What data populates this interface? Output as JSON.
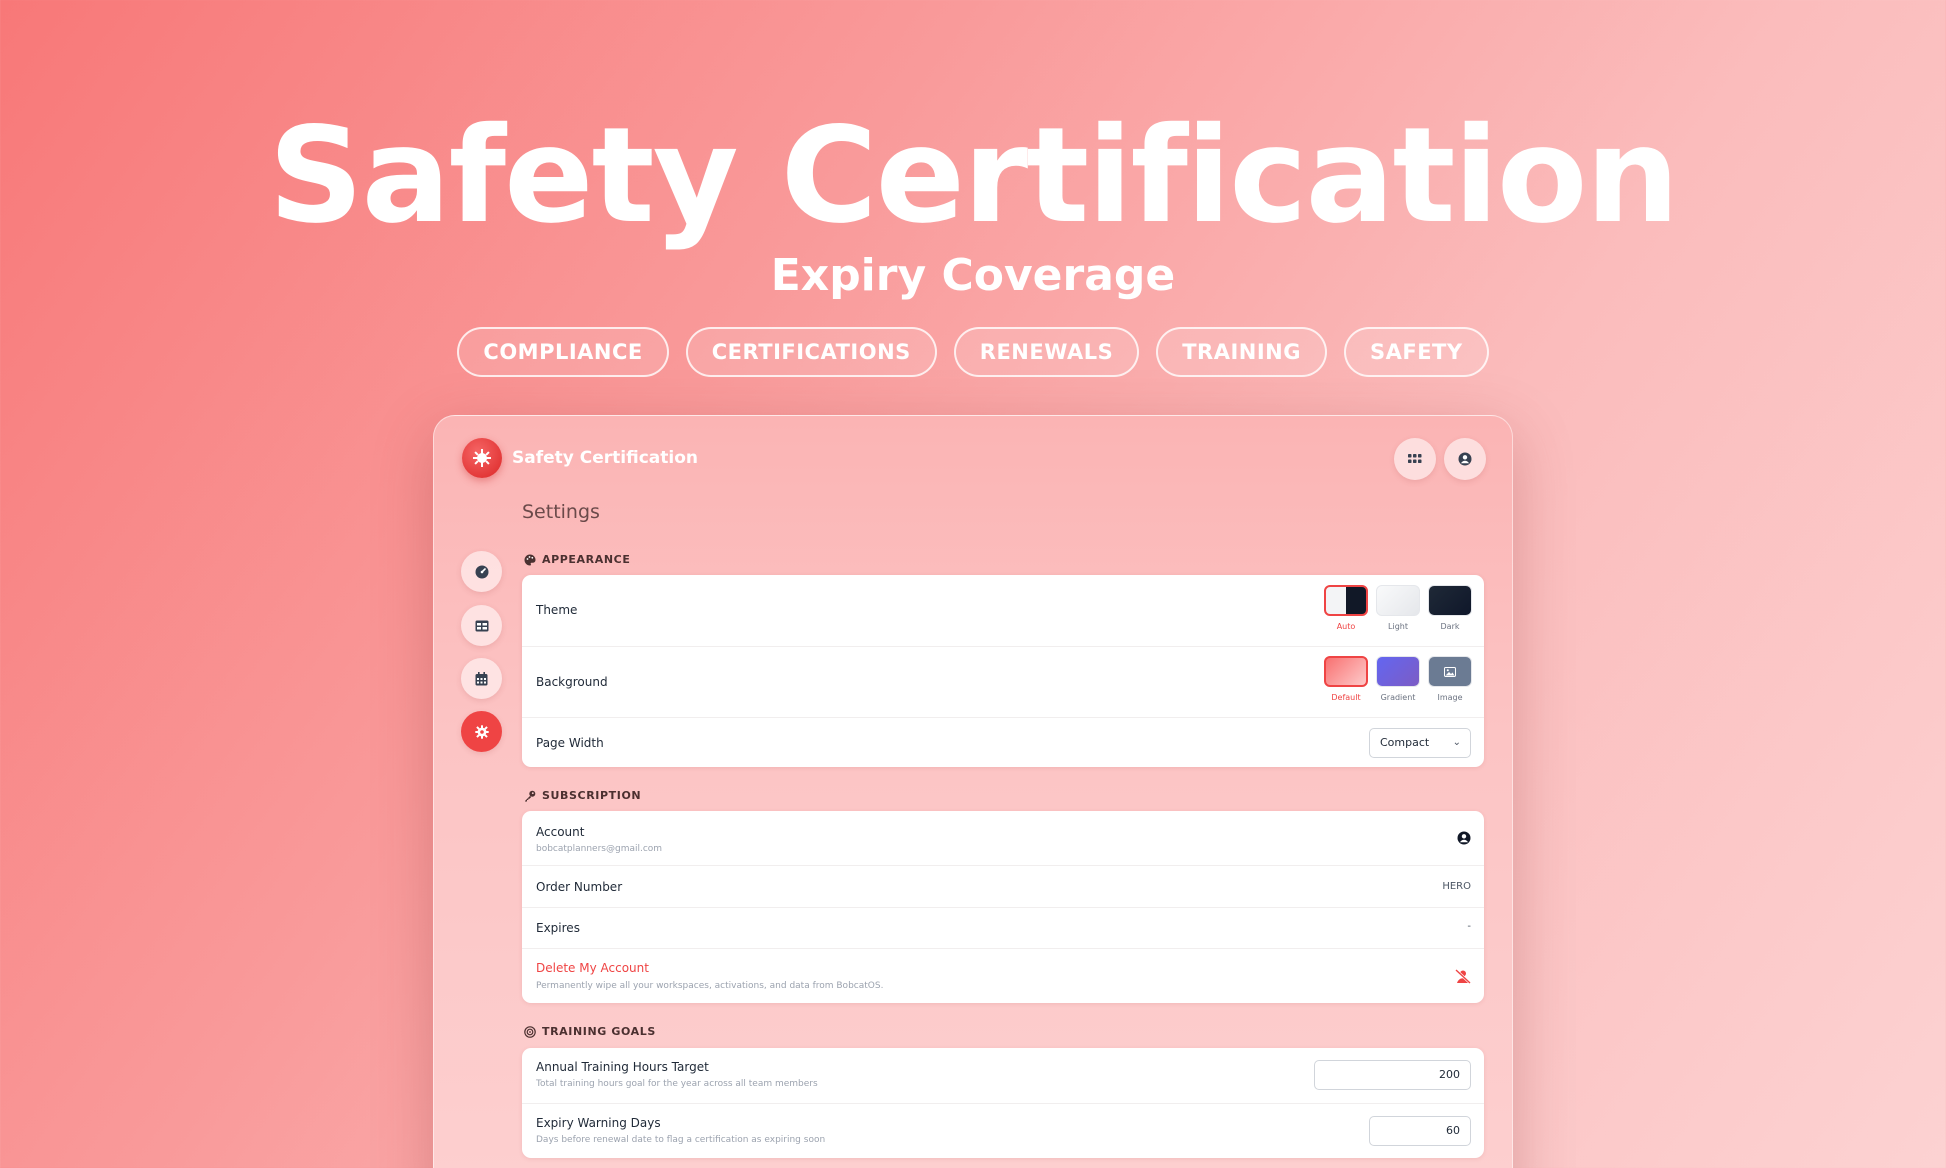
{
  "hero": {
    "title": "Safety Certification",
    "subtitle": "Expiry Coverage",
    "tags": [
      "COMPLIANCE",
      "CERTIFICATIONS",
      "RENEWALS",
      "TRAINING",
      "SAFETY"
    ]
  },
  "app": {
    "name": "Safety Certification",
    "page_title": "Settings",
    "accent": "#ef4444"
  },
  "appearance": {
    "section": "APPEARANCE",
    "theme_label": "Theme",
    "theme_options": [
      "Auto",
      "Light",
      "Dark"
    ],
    "theme_selected": "Auto",
    "background_label": "Background",
    "background_options": [
      "Default",
      "Gradient",
      "Image"
    ],
    "background_selected": "Default",
    "page_width_label": "Page Width",
    "page_width_value": "Compact"
  },
  "subscription": {
    "section": "SUBSCRIPTION",
    "account_label": "Account",
    "account_email": "bobcatplanners@gmail.com",
    "order_label": "Order Number",
    "order_value": "HERO",
    "expires_label": "Expires",
    "expires_value": "-",
    "delete_label": "Delete My Account",
    "delete_desc": "Permanently wipe all your workspaces, activations, and data from BobcatOS."
  },
  "training": {
    "section": "TRAINING GOALS",
    "hours_label": "Annual Training Hours Target",
    "hours_desc": "Total training hours goal for the year across all team members",
    "hours_value": "200",
    "warning_label": "Expiry Warning Days",
    "warning_desc": "Days before renewal date to flag a certification as expiring soon",
    "warning_value": "60"
  }
}
